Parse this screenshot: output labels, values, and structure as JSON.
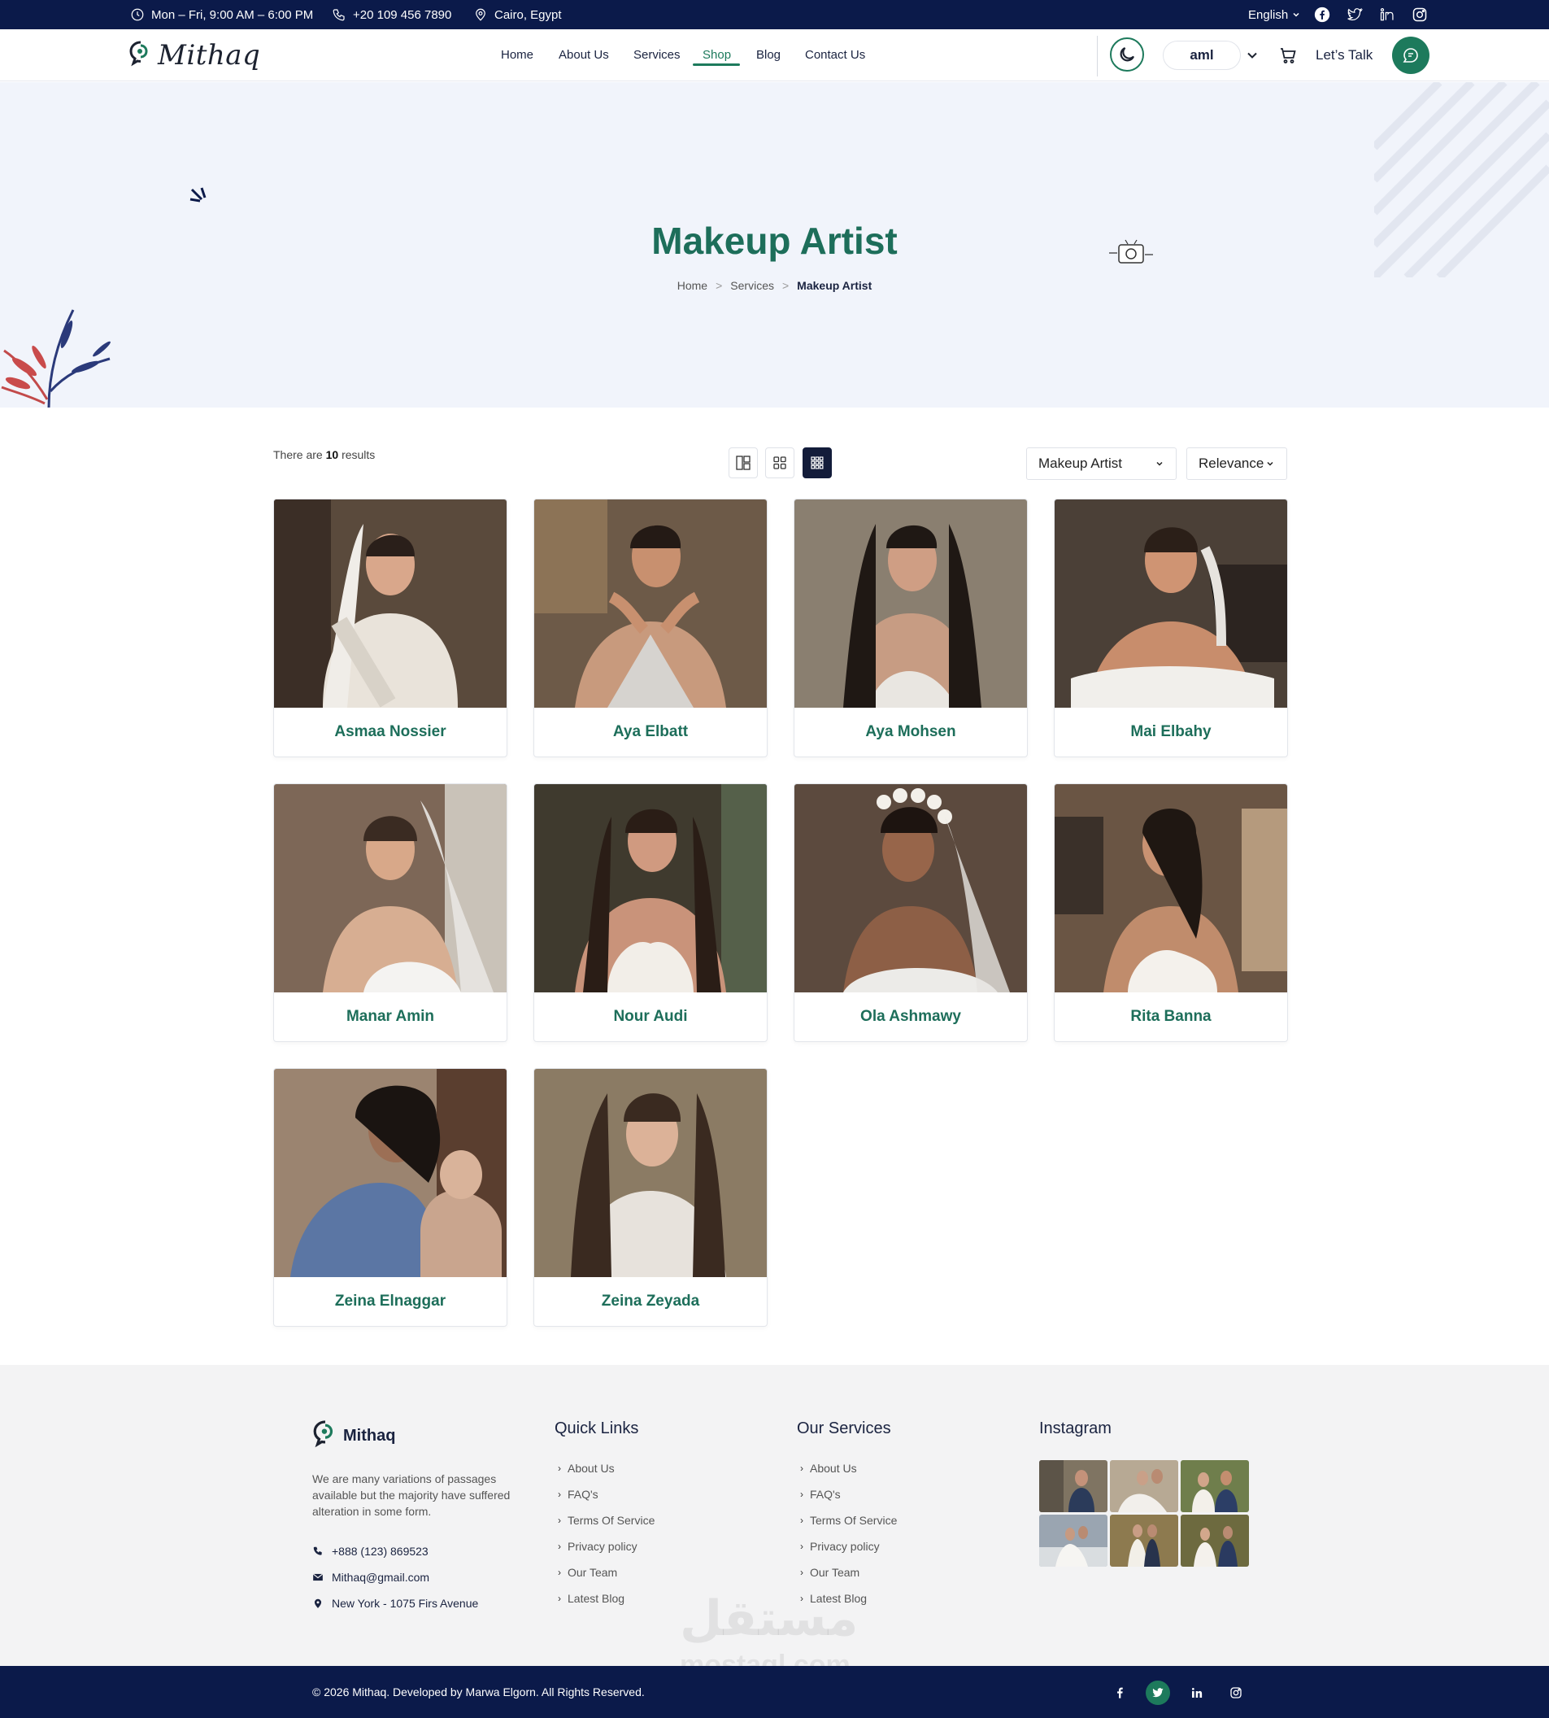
{
  "topbar": {
    "hours": "Mon – Fri, 9:00 AM – 6:00 PM",
    "phone": "+20 109 456 7890",
    "location": "Cairo, Egypt",
    "language": "English"
  },
  "header": {
    "brand": "Mithaq",
    "nav": [
      "Home",
      "About Us",
      "Services",
      "Shop",
      "Blog",
      "Contact Us"
    ],
    "active_nav": "Shop",
    "user": "aml",
    "talk": "Let’s Talk"
  },
  "hero": {
    "title": "Makeup Artist",
    "breadcrumb": [
      "Home",
      "Services",
      "Makeup Artist"
    ],
    "separator": ">"
  },
  "toolbar": {
    "results_prefix": "There are",
    "results_count": "10",
    "results_suffix": "results",
    "category_select": "Makeup Artist",
    "sort_select": "Relevance"
  },
  "artists": [
    {
      "name": "Asmaa Nossier"
    },
    {
      "name": "Aya Elbatt"
    },
    {
      "name": "Aya Mohsen"
    },
    {
      "name": "Mai Elbahy"
    },
    {
      "name": "Manar Amin"
    },
    {
      "name": "Nour Audi"
    },
    {
      "name": "Ola Ashmawy"
    },
    {
      "name": "Rita Banna"
    },
    {
      "name": "Zeina Elnaggar"
    },
    {
      "name": "Zeina Zeyada"
    }
  ],
  "footer": {
    "brand": "Mithaq",
    "description": "We are many variations of passages available but the majority have suffered alteration in some form.",
    "phone": "+888 (123) 869523",
    "email": "Mithaq@gmail.com",
    "address": "New York - 1075 Firs Avenue",
    "quick_links_title": "Quick Links",
    "quick_links": [
      "About Us",
      "FAQ's",
      "Terms Of Service",
      "Privacy policy",
      "Our Team",
      "Latest Blog"
    ],
    "services_title": "Our Services",
    "services_links": [
      "About Us",
      "FAQ's",
      "Terms Of Service",
      "Privacy policy",
      "Our Team",
      "Latest Blog"
    ],
    "instagram_title": "Instagram",
    "copyright": "© 2026 Mithaq. Developed by Marwa Elgorn. All Rights Reserved."
  },
  "watermark": {
    "arabic": "مستقل",
    "latin": "mostaql.com"
  },
  "colors": {
    "navy": "#0b1a4a",
    "green": "#1d7a5c",
    "hero_bg": "#f1f4fb"
  }
}
